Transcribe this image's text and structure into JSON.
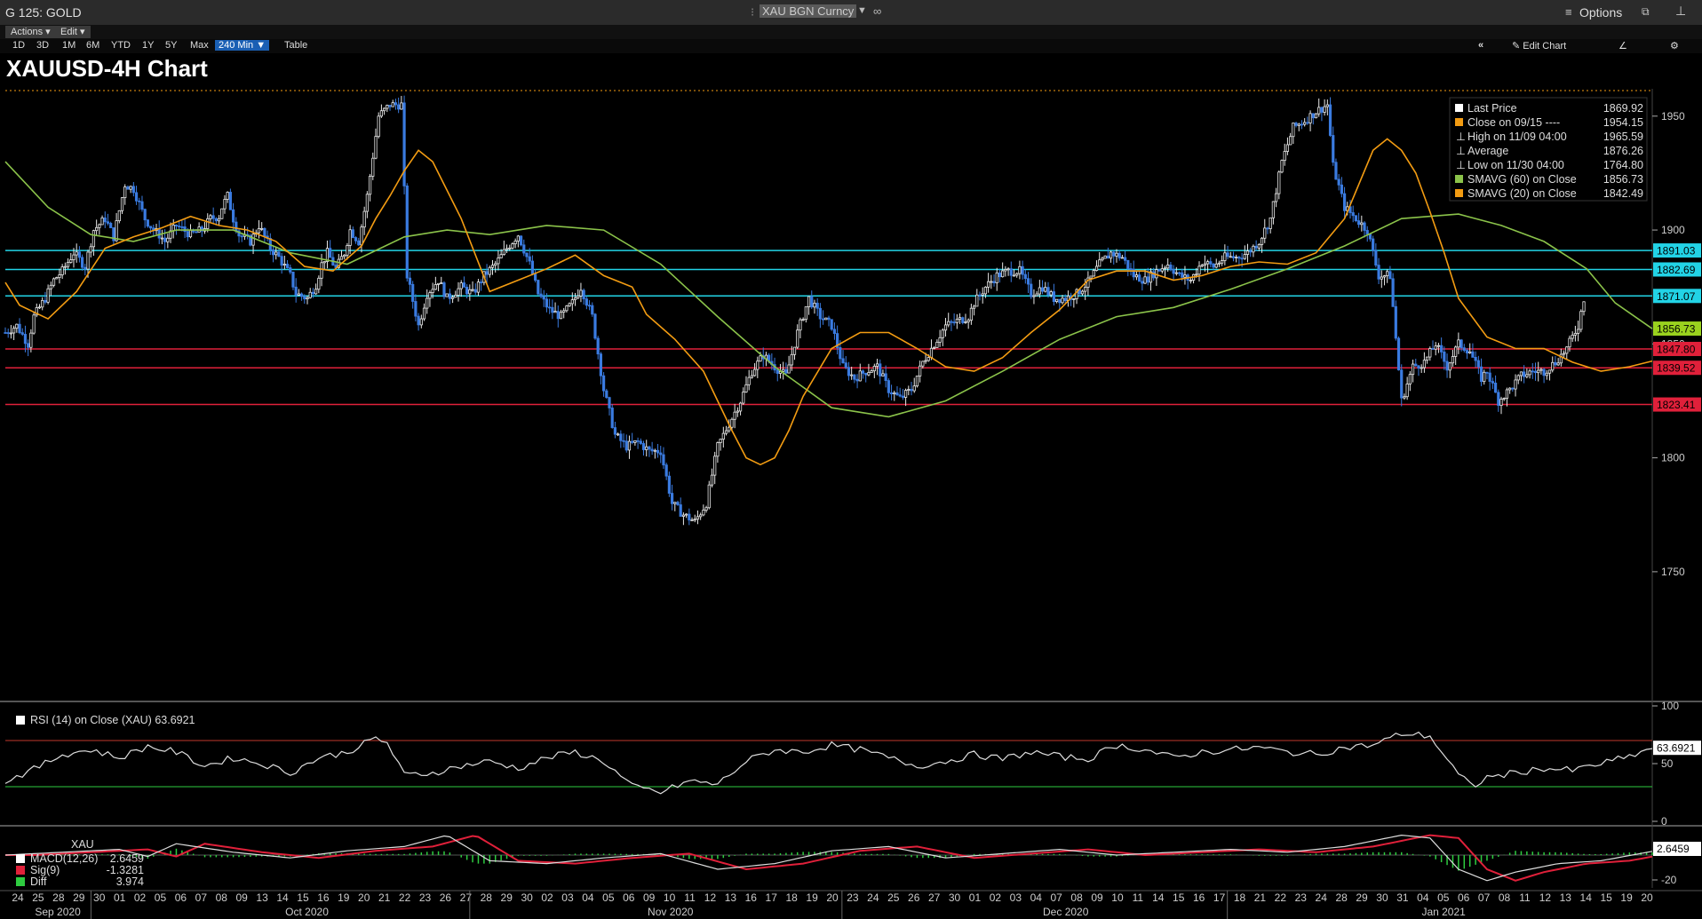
{
  "window": {
    "title": "G 125: GOLD",
    "security": "XAU BGN Curncy",
    "options_label": "Options",
    "actions_label": "Actions",
    "edit_label": "Edit",
    "edit_chart_label": "Edit Chart",
    "table_label": "Table",
    "timeframes": [
      "1D",
      "3D",
      "1M",
      "6M",
      "YTD",
      "1Y",
      "5Y",
      "Max"
    ],
    "selected_timeframe": "240 Min"
  },
  "chart_data": {
    "type": "line",
    "title": "XAUUSD-4H Chart",
    "ylim": [
      1695,
      1962
    ],
    "y_ticks": [
      1750,
      1800,
      1850,
      1900,
      1950
    ],
    "x_labels": {
      "days": [
        "24",
        "25",
        "28",
        "29",
        "30",
        "01",
        "02",
        "05",
        "06",
        "07",
        "08",
        "09",
        "13",
        "14",
        "15",
        "16",
        "19",
        "20",
        "21",
        "22",
        "23",
        "26",
        "27",
        "28",
        "29",
        "30",
        "02",
        "03",
        "04",
        "05",
        "06",
        "09",
        "10",
        "11",
        "12",
        "13",
        "16",
        "17",
        "18",
        "19",
        "20",
        "23",
        "24",
        "25",
        "26",
        "27",
        "30",
        "01",
        "02",
        "03",
        "04",
        "07",
        "08",
        "09",
        "10",
        "11",
        "14",
        "15",
        "16",
        "17",
        "18",
        "21",
        "22",
        "23",
        "24",
        "28",
        "29",
        "30",
        "31",
        "04",
        "05",
        "06",
        "07",
        "08",
        "11",
        "12",
        "13",
        "14",
        "15",
        "19",
        "20"
      ],
      "months": [
        "Sep 2020",
        "Oct 2020",
        "Nov 2020",
        "Dec 2020",
        "Jan 2021"
      ]
    },
    "price_series": {
      "name": "XAU",
      "x": [
        0,
        4,
        8,
        10,
        14,
        17,
        20,
        24,
        28,
        31,
        35,
        38,
        42,
        45,
        49,
        52,
        54,
        56,
        60,
        65,
        69,
        72,
        75,
        76,
        78,
        80,
        82,
        86,
        89,
        93,
        96,
        100,
        102,
        106,
        109,
        111,
        113,
        116,
        119,
        121,
        124,
        127,
        131,
        135,
        139,
        141,
        145,
        148,
        152,
        155,
        160,
        164,
        168,
        172,
        176,
        180,
        184,
        187,
        191,
        195,
        199,
        202,
        206,
        210,
        214,
        218,
        222,
        226,
        230,
        234,
        238,
        242,
        246,
        250,
        254,
        258,
        262,
        266,
        270,
        274,
        278,
        282,
        286,
        290,
        294,
        298,
        302,
        306,
        310,
        314,
        318,
        322,
        326,
        330,
        334,
        338,
        340,
        344,
        348,
        352,
        356,
        360,
        364,
        368,
        372,
        376,
        380,
        384,
        388,
        392,
        396,
        400,
        404,
        408,
        412,
        416,
        420,
        424,
        428,
        432,
        436,
        440,
        444,
        448,
        452,
        456,
        460,
        464,
        466,
        470,
        474,
        478,
        482,
        486,
        490,
        494,
        498,
        502,
        506,
        510,
        514,
        518,
        520,
        524,
        528,
        532,
        536,
        540,
        544,
        548,
        552,
        554,
        558,
        562,
        566,
        570,
        574,
        578
      ],
      "values": [
        1855,
        1858,
        1850,
        1862,
        1870,
        1878,
        1882,
        1890,
        1884,
        1900,
        1905,
        1897,
        1920,
        1918,
        1905,
        1900,
        1898,
        1895,
        1902,
        1898,
        1900,
        1905,
        1906,
        1910,
        1915,
        1905,
        1898,
        1895,
        1902,
        1892,
        1888,
        1880,
        1872,
        1870,
        1876,
        1885,
        1890,
        1883,
        1890,
        1900,
        1895,
        1915,
        1950,
        1955,
        1955,
        1880,
        1858,
        1872,
        1878,
        1870,
        1875,
        1872,
        1880,
        1885,
        1892,
        1898,
        1885,
        1872,
        1865,
        1862,
        1868,
        1875,
        1862,
        1830,
        1810,
        1805,
        1807,
        1803,
        1803,
        1780,
        1775,
        1772,
        1780,
        1805,
        1815,
        1825,
        1838,
        1845,
        1840,
        1836,
        1855,
        1870,
        1862,
        1858,
        1840,
        1835,
        1838,
        1840,
        1830,
        1826,
        1830,
        1842,
        1850,
        1858,
        1860,
        1862,
        1868,
        1875,
        1880,
        1882,
        1882,
        1872,
        1875,
        1870,
        1870,
        1872,
        1877,
        1885,
        1890,
        1888,
        1880,
        1878,
        1882,
        1885,
        1880,
        1878,
        1886,
        1884,
        1888,
        1888,
        1890,
        1895,
        1905,
        1930,
        1945,
        1948,
        1952,
        1955,
        1928,
        1910,
        1905,
        1900,
        1880,
        1880,
        1825,
        1840,
        1842,
        1850,
        1840,
        1850,
        1847,
        1835,
        1838,
        1825,
        1830,
        1836,
        1838,
        1838,
        1842,
        1848,
        1858,
        1870
      ],
      "last_price": 1869.92
    },
    "sma20": {
      "name": "SMAVG (20) on Close",
      "x": [
        0,
        5,
        15,
        25,
        35,
        45,
        55,
        65,
        75,
        85,
        95,
        105,
        115,
        125,
        130,
        135,
        140,
        145,
        150,
        160,
        170,
        180,
        190,
        200,
        210,
        220,
        225,
        235,
        245,
        250,
        255,
        260,
        265,
        270,
        275,
        280,
        290,
        300,
        310,
        320,
        330,
        340,
        350,
        360,
        370,
        380,
        390,
        400,
        410,
        420,
        430,
        440,
        450,
        460,
        470,
        475,
        480,
        485,
        490,
        495,
        500,
        505,
        510,
        520,
        530,
        540,
        550,
        560,
        570,
        578
      ],
      "values": [
        1877,
        1867,
        1861,
        1873,
        1892,
        1897,
        1901,
        1906,
        1902,
        1900,
        1895,
        1884,
        1882,
        1893,
        1905,
        1915,
        1926,
        1935,
        1930,
        1905,
        1873,
        1878,
        1883,
        1889,
        1880,
        1875,
        1863,
        1852,
        1838,
        1825,
        1812,
        1800,
        1797,
        1800,
        1812,
        1827,
        1848,
        1855,
        1855,
        1848,
        1840,
        1838,
        1844,
        1855,
        1865,
        1878,
        1882,
        1882,
        1878,
        1880,
        1884,
        1886,
        1885,
        1890,
        1905,
        1920,
        1935,
        1940,
        1935,
        1925,
        1908,
        1890,
        1870,
        1853,
        1848,
        1848,
        1842,
        1838,
        1840,
        1842.5
      ]
    },
    "sma60": {
      "name": "SMAVG (60) on Close",
      "x": [
        0,
        15,
        30,
        45,
        60,
        80,
        100,
        120,
        140,
        155,
        170,
        190,
        210,
        230,
        250,
        270,
        290,
        310,
        330,
        350,
        370,
        390,
        410,
        430,
        450,
        470,
        490,
        510,
        525,
        540,
        555,
        565,
        578
      ],
      "values": [
        1930,
        1910,
        1898,
        1895,
        1900,
        1900,
        1890,
        1885,
        1897,
        1900,
        1898,
        1902,
        1900,
        1885,
        1862,
        1840,
        1822,
        1818,
        1825,
        1838,
        1852,
        1862,
        1866,
        1874,
        1883,
        1893,
        1905,
        1907,
        1902,
        1895,
        1883,
        1868,
        1856.7
      ]
    },
    "horizontal_levels": [
      {
        "value": 1891.03,
        "color": "#22d3e6",
        "label": "1891.03"
      },
      {
        "value": 1882.69,
        "color": "#22d3e6",
        "label": "1882.69"
      },
      {
        "value": 1871.07,
        "color": "#22d3e6",
        "label": "1871.07"
      },
      {
        "value": 1847.8,
        "color": "#e0203a",
        "label": "1847.80"
      },
      {
        "value": 1839.52,
        "color": "#e0203a",
        "label": "1839.52"
      },
      {
        "value": 1823.41,
        "color": "#e0203a",
        "label": "1823.41"
      }
    ],
    "axis_badges": [
      {
        "value": 1856.73,
        "label": "1856.73",
        "color": "#9ad21e"
      }
    ],
    "legend": {
      "placement": "top-right",
      "rows": [
        {
          "label": "Last Price",
          "value": "1869.92",
          "swatch": "#ffffff"
        },
        {
          "label": "Close on 09/15 ----",
          "value": "1954.15",
          "swatch": "#f39c12"
        },
        {
          "label": "High on 11/09 04:00",
          "value": "1965.59",
          "swatch": "none"
        },
        {
          "label": "Average",
          "value": "1876.26",
          "swatch": "none"
        },
        {
          "label": "Low on 11/30 04:00",
          "value": "1764.80",
          "swatch": "none"
        },
        {
          "label": "SMAVG (60)  on Close",
          "value": "1856.73",
          "swatch": "#8bc34a"
        },
        {
          "label": "SMAVG (20)  on Close",
          "value": "1842.49",
          "swatch": "#f39c12"
        }
      ]
    },
    "rsi": {
      "legend": "RSI (14)  on Close (XAU) 63.6921",
      "last": "63.6921",
      "y_ticks": [
        0,
        50,
        100
      ],
      "upper": 70,
      "lower": 30,
      "x": [
        0,
        10,
        20,
        30,
        40,
        50,
        60,
        70,
        80,
        90,
        100,
        110,
        120,
        130,
        134,
        140,
        150,
        160,
        170,
        180,
        190,
        200,
        210,
        220,
        230,
        240,
        250,
        260,
        270,
        280,
        290,
        300,
        310,
        320,
        330,
        340,
        350,
        360,
        370,
        380,
        390,
        400,
        410,
        420,
        430,
        440,
        450,
        460,
        470,
        480,
        490,
        500,
        510,
        515,
        520,
        530,
        540,
        550,
        560,
        570,
        578
      ],
      "values": [
        35,
        45,
        58,
        62,
        55,
        65,
        60,
        48,
        55,
        50,
        42,
        55,
        60,
        72,
        68,
        40,
        42,
        48,
        52,
        46,
        55,
        60,
        52,
        30,
        25,
        35,
        32,
        52,
        62,
        60,
        66,
        62,
        55,
        48,
        52,
        58,
        54,
        60,
        56,
        54,
        66,
        62,
        55,
        60,
        62,
        64,
        60,
        58,
        64,
        66,
        76,
        74,
        40,
        30,
        38,
        42,
        46,
        44,
        50,
        56,
        63.7
      ]
    },
    "macd": {
      "legend_title": "XAU",
      "rows": [
        {
          "label": "MACD(12,26)",
          "value": "2.6459",
          "color": "#ffffff"
        },
        {
          "label": "Sig(9)",
          "value": "-1.3281",
          "color": "#e0203a"
        },
        {
          "label": "Diff",
          "value": "3.974",
          "color": "#2ecc40"
        }
      ],
      "last": "2.6459",
      "y_ticks": [
        "-20"
      ],
      "x": [
        0,
        20,
        40,
        50,
        60,
        80,
        100,
        120,
        140,
        155,
        170,
        190,
        210,
        230,
        250,
        270,
        290,
        310,
        330,
        350,
        370,
        390,
        410,
        430,
        450,
        470,
        490,
        500,
        510,
        520,
        530,
        545,
        560,
        578
      ],
      "values": [
        0,
        2,
        4,
        -1,
        8,
        2,
        -2,
        3,
        6,
        14,
        -4,
        -6,
        -2,
        1,
        -10,
        -6,
        3,
        6,
        -2,
        1,
        4,
        0,
        2,
        4,
        2,
        6,
        14,
        12,
        -10,
        -18,
        -12,
        -6,
        -4,
        2.6
      ]
    }
  }
}
